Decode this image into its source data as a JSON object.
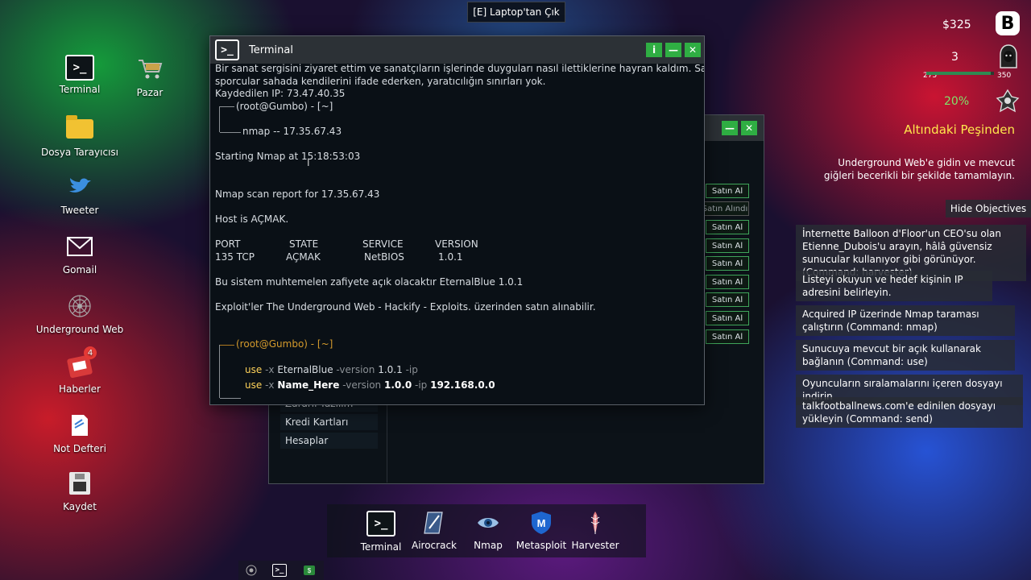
{
  "top_prompt": "[E] Laptop'tan Çık",
  "desktop": {
    "icons": [
      {
        "label": "Terminal"
      },
      {
        "label": "Pazar"
      },
      {
        "label": "Dosya Tarayıcısı"
      },
      {
        "label": "Tweeter"
      },
      {
        "label": "Gomail"
      },
      {
        "label": "Underground Web"
      },
      {
        "label": "Haberler",
        "badge": "4"
      },
      {
        "label": "Not Defteri"
      },
      {
        "label": "Kaydet"
      }
    ]
  },
  "terminal": {
    "title": "Terminal",
    "buttons": {
      "info": "i",
      "minimize": "—",
      "close": "✕"
    },
    "lines": {
      "partial1": "Bir sanat sergisini ziyaret ettim ve sanatçıların işlerinde duyguları nasıl ilettiklerine hayran kaldım. Sanki",
      "partial2": "sporcular sahada kendilerini ifade ederken, yaratıcılığın sınırları yok.",
      "saved_ip": "Kaydedilen IP: 73.47.40.35",
      "prompt1": "(root@Gumbo) - [~]",
      "cmd1": "nmap -- 17.35.67.43",
      "starting": "Starting Nmap at 15:18:53:03",
      "report": "Nmap scan report for 17.35.67.43",
      "host": "Host is AÇMAK.",
      "headers": {
        "port": "PORT",
        "state": "STATE",
        "service": "SERVICE",
        "version": "VERSION"
      },
      "row": {
        "port": "135 TCP",
        "state": "AÇMAK",
        "service": "NetBIOS",
        "version": "1.0.1"
      },
      "vuln": "Bu sistem muhtemelen zafiyete açık olacaktır EternalBlue 1.0.1",
      "exploit": "Exploit'ler The Underground Web - Hackify - Exploits. üzerinden satın alınabilir.",
      "prompt2": "(root@Gumbo) - [~]",
      "use1": {
        "use": "use",
        "x": "-x",
        "name": "EternalBlue",
        "vflag": "-version",
        "ver": "1.0.1",
        "ipflag": "-ip"
      },
      "use2": {
        "use": "use",
        "x": "-x",
        "name": "Name_Here",
        "vflag": "-version",
        "ver": "1.0.0",
        "ipflag": "-ip",
        "ip": "192.168.0.0"
      }
    }
  },
  "store": {
    "sidebar": [
      "Zararlı Yazılım",
      "Kredi Kartları",
      "Hesaplar"
    ],
    "buy_label": "Satın Al",
    "bought_label": "Satın Alındı"
  },
  "hud": {
    "money": "$325",
    "level": "3",
    "xp_min": "275",
    "xp_max": "350",
    "xp_fraction": 0.95,
    "heat": "20%",
    "colors": {
      "heat": "#7fe36b",
      "objective_title": "#ffe74c"
    }
  },
  "objectives": {
    "title": "Altındaki Peşinden",
    "description": "Underground Web'e gidin ve mevcut giğleri becerikli bir şekilde tamamlayın.",
    "hide_label": "Hide Objectives",
    "items": [
      "İnternette Balloon d'Floor'un CEO'su olan Etienne_Dubois'u arayın, hâlâ güvensiz sunucular kullanıyor gibi görünüyor. (Command: harvester)",
      "Listeyi okuyun ve hedef kişinin IP adresini belirleyin.",
      "Acquired IP üzerinde Nmap taraması çalıştırın (Command: nmap)",
      "Sunucuya mevcut bir açık kullanarak bağlanın (Command: use)",
      "Oyuncuların sıralamalarını içeren dosyayı indirin",
      "talkfootballnews.com'e edinilen dosyayı yükleyin (Command: send)"
    ]
  },
  "dock": {
    "items": [
      {
        "label": "Terminal"
      },
      {
        "label": "Airocrack"
      },
      {
        "label": "Nmap"
      },
      {
        "label": "Metasploit"
      },
      {
        "label": "Harvester"
      }
    ]
  }
}
